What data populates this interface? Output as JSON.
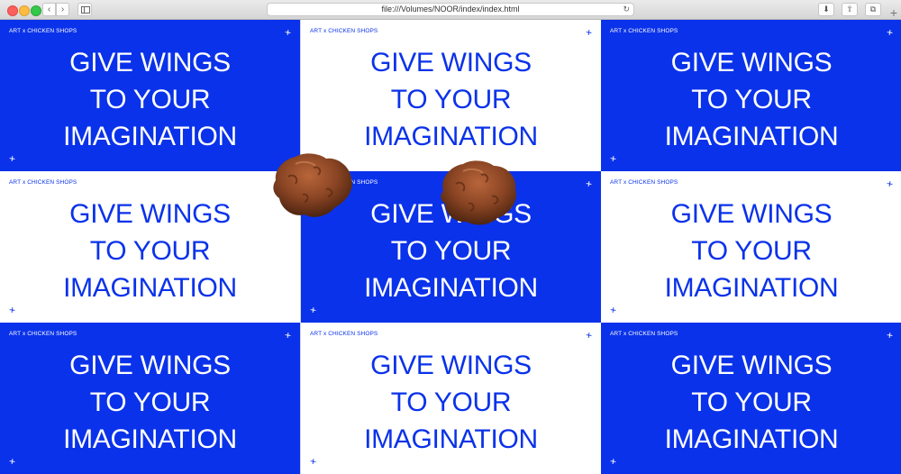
{
  "browser": {
    "url": "file:///Volumes/NOOR/index/index.html",
    "back_icon": "‹",
    "forward_icon": "›",
    "reload_icon": "↻",
    "download_icon": "⬇",
    "share_icon": "⇧",
    "tabs_icon": "⧉",
    "new_tab_icon": "+"
  },
  "colors": {
    "brand_blue": "#0a32ea",
    "white": "#ffffff"
  },
  "tiles": [
    {
      "theme": "blue",
      "label": "ART x CHICKEN SHOPS",
      "line1": "GIVE WINGS",
      "line2": "TO YOUR",
      "line3": "IMAGINATION",
      "plus": "+"
    },
    {
      "theme": "white",
      "label": "ART x CHICKEN SHOPS",
      "line1": "GIVE WINGS",
      "line2": "TO YOUR",
      "line3": "IMAGINATION",
      "plus": "+"
    },
    {
      "theme": "blue",
      "label": "ART x CHICKEN SHOPS",
      "line1": "GIVE WINGS",
      "line2": "TO YOUR",
      "line3": "IMAGINATION",
      "plus": "+"
    },
    {
      "theme": "white",
      "label": "ART x CHICKEN SHOPS",
      "line1": "GIVE WINGS",
      "line2": "TO YOUR",
      "line3": "IMAGINATION",
      "plus": "+"
    },
    {
      "theme": "blue",
      "label": "ART x CHICKEN SHOPS",
      "line1": "GIVE WINGS",
      "line2": "TO YOUR",
      "line3": "IMAGINATION",
      "plus": "+"
    },
    {
      "theme": "white",
      "label": "ART x CHICKEN SHOPS",
      "line1": "GIVE WINGS",
      "line2": "TO YOUR",
      "line3": "IMAGINATION",
      "plus": "+"
    },
    {
      "theme": "blue",
      "label": "ART x CHICKEN SHOPS",
      "line1": "GIVE WINGS",
      "line2": "TO YOUR",
      "line3": "IMAGINATION",
      "plus": "+"
    },
    {
      "theme": "white",
      "label": "ART x CHICKEN SHOPS",
      "line1": "GIVE WINGS",
      "line2": "TO YOUR",
      "line3": "IMAGINATION",
      "plus": "+"
    },
    {
      "theme": "blue",
      "label": "ART x CHICKEN SHOPS",
      "line1": "GIVE WINGS",
      "line2": "TO YOUR",
      "line3": "IMAGINATION",
      "plus": "+"
    }
  ]
}
